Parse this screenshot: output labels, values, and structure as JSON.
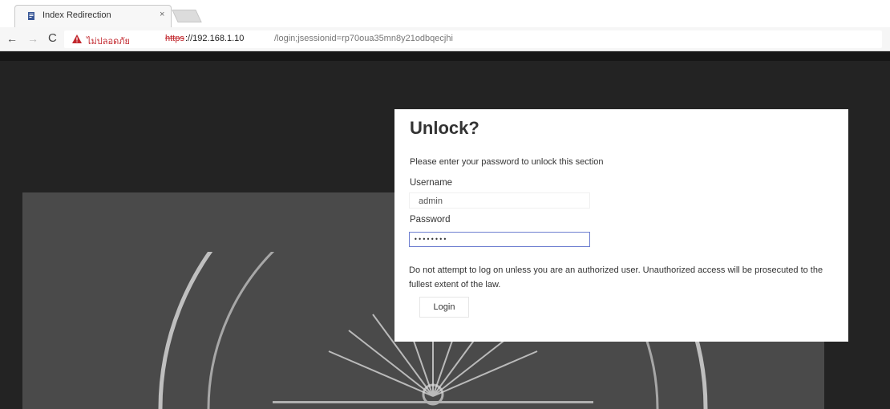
{
  "browser": {
    "tab": {
      "title": "Index Redirection",
      "close_glyph": "×"
    },
    "nav": {
      "back_glyph": "←",
      "forward_glyph": "→",
      "reload_glyph": "C"
    },
    "address_bar": {
      "security_label": "ไม่ปลอดภัย",
      "scheme": "https",
      "host": "://192.168.1.10",
      "path": "/login;jsessionid=rp70oua35mn8y21odbqecjhi"
    }
  },
  "dialog": {
    "title": "Unlock?",
    "instruction": "Please enter your password to unlock this section",
    "username_label": "Username",
    "username_value": "admin",
    "password_label": "Password",
    "password_value": "••••••••",
    "warning": "Do not attempt to log on unless you are an authorized user. Unauthorized access will be prosecuted to the fullest extent of the law.",
    "login_label": "Login"
  },
  "icons": {
    "favicon": "document-icon",
    "security": "warning-triangle-icon"
  },
  "colors": {
    "insecure_red": "#c2272d",
    "page_background": "#232323",
    "panel_grey": "#4a4a4a",
    "focus_border": "#6d7ed0"
  }
}
